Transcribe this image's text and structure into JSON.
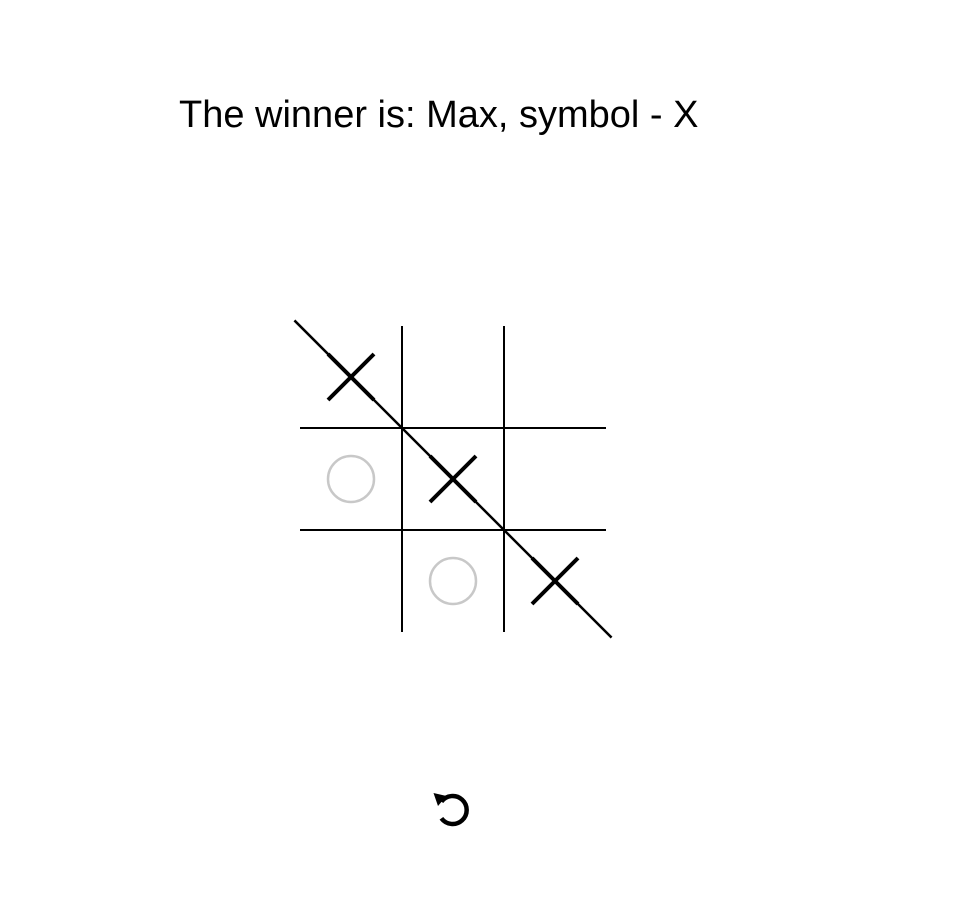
{
  "game": {
    "winner_text": "The winner is: Max, symbol - X",
    "cells": [
      "X",
      "",
      "",
      "O",
      "X",
      "",
      "",
      "O",
      "X"
    ],
    "winning_line": [
      0,
      4,
      8
    ]
  },
  "controls": {
    "restart_icon": "restart-icon"
  },
  "colors": {
    "x_mark": "#000000",
    "o_mark": "#c8c8c8",
    "grid": "#000000",
    "win_line": "#000000"
  }
}
